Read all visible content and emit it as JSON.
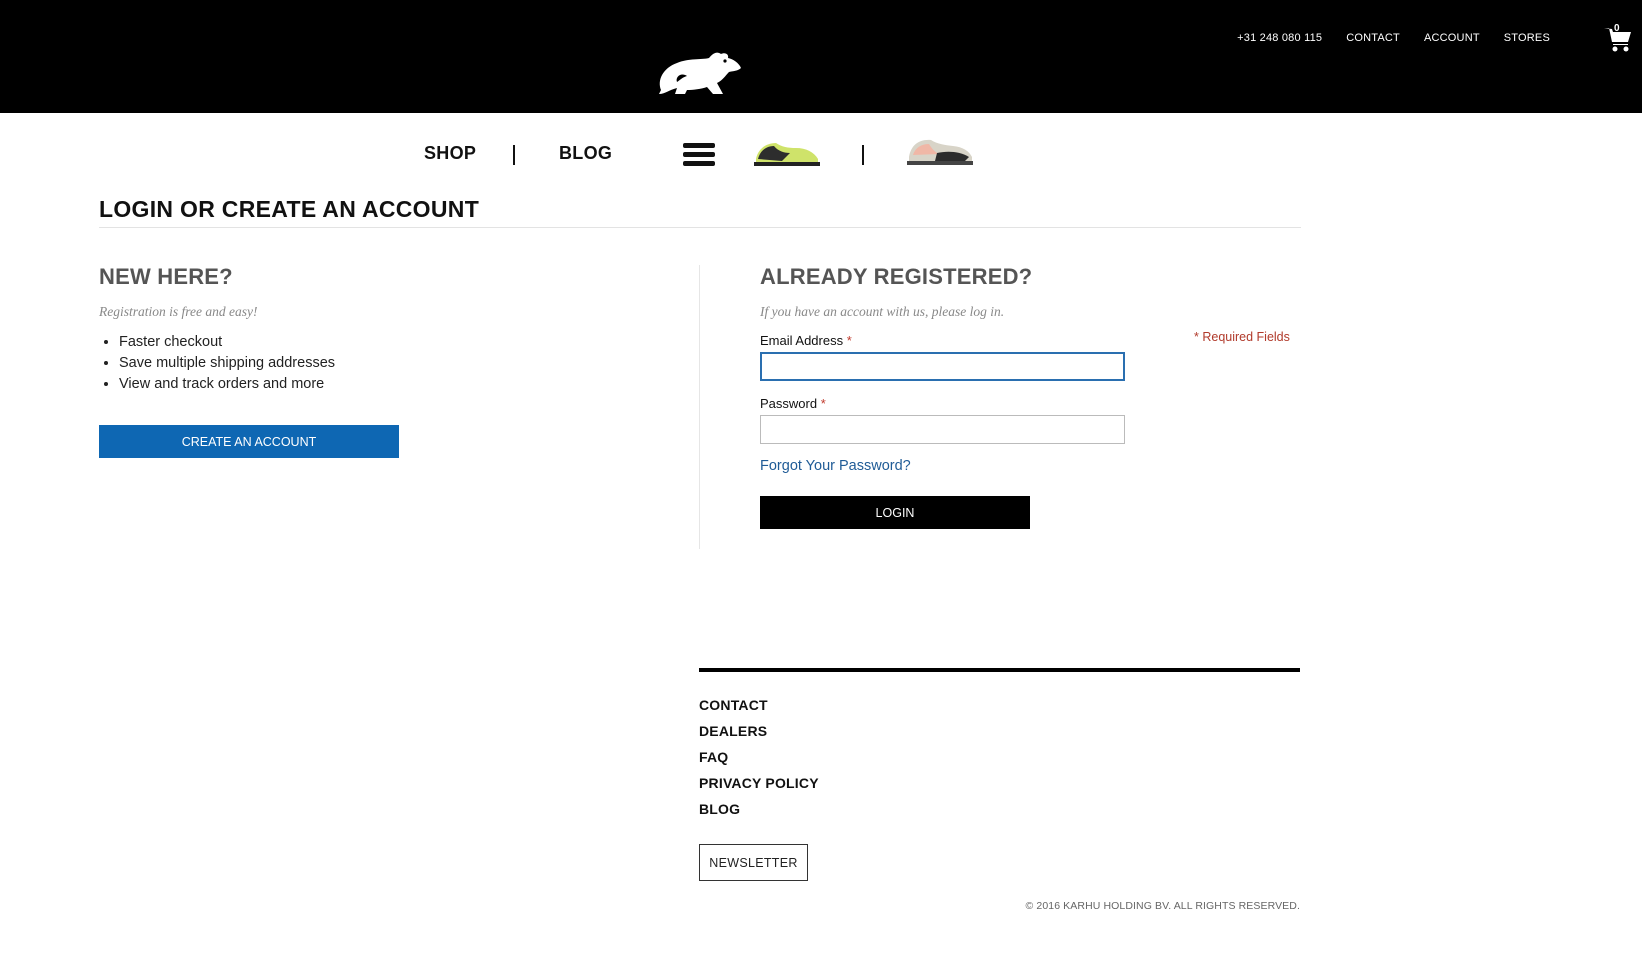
{
  "header": {
    "logo_icon": "bear-logo-icon",
    "links": [
      "+31 248 080 115",
      "CONTACT",
      "ACCOUNT",
      "STORES"
    ],
    "cart_count": "0",
    "cart_icon": "shopping-cart-icon"
  },
  "nav": {
    "shop_label": "SHOP",
    "blog_label": "BLOG",
    "menu_icon": "hamburger-menu-icon",
    "shoe_icons": [
      "green-sneaker-icon",
      "pink-sneaker-icon"
    ]
  },
  "page": {
    "title": "LOGIN OR CREATE AN ACCOUNT"
  },
  "new_customer": {
    "heading": "NEW HERE?",
    "subtitle": "Registration is free and easy!",
    "benefits": [
      "Faster checkout",
      "Save multiple shipping addresses",
      "View and track orders and more"
    ],
    "button_label": "CREATE AN ACCOUNT"
  },
  "login": {
    "heading": "ALREADY REGISTERED?",
    "subtitle": "If you have an account with us, please log in.",
    "required_note": "* Required Fields",
    "email_label": "Email Address",
    "email_value": "",
    "password_label": "Password",
    "password_value": "",
    "required_mark": "*",
    "forgot_label": "Forgot Your Password?",
    "button_label": "LOGIN"
  },
  "footer": {
    "links": [
      "CONTACT",
      "DEALERS",
      "FAQ",
      "PRIVACY POLICY",
      "BLOG"
    ],
    "newsletter_label": "NEWSLETTER",
    "copyright": "© 2016 KARHU HOLDING BV. ALL RIGHTS RESERVED."
  },
  "colors": {
    "header_bg": "#000000",
    "primary_button": "#0e67b3",
    "required": "#c0392b",
    "link": "#1f5b96"
  }
}
